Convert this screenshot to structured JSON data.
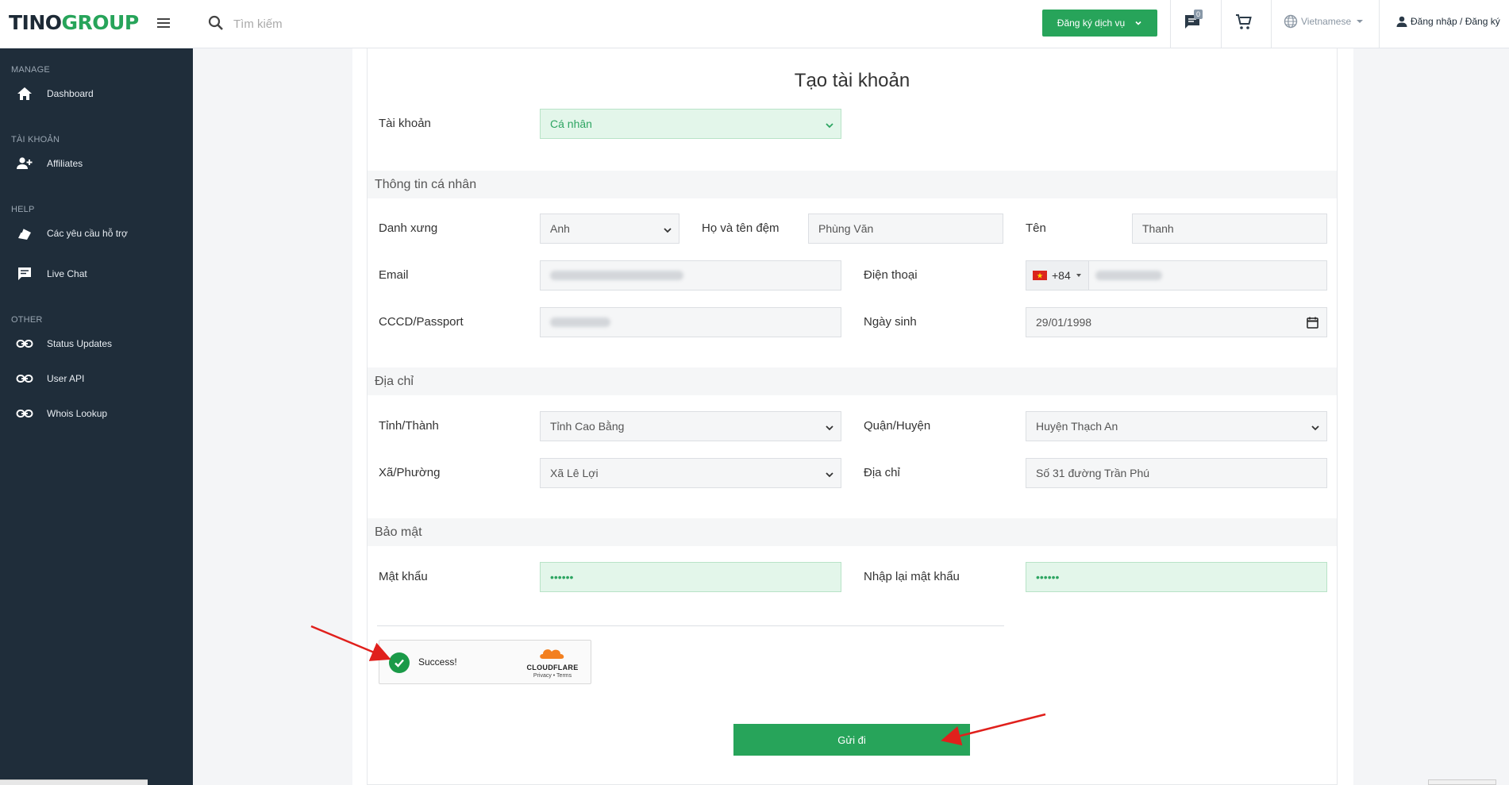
{
  "app": {
    "logo_part1": "TINO",
    "logo_part2": "GROUP"
  },
  "topbar": {
    "search_placeholder": "Tìm kiếm",
    "register_label": "Đăng ký dịch vụ",
    "chat_badge": "0",
    "language": "Vietnamese",
    "login_label": "Đăng nhập / Đăng ký"
  },
  "sidebar": {
    "sections": [
      {
        "title": "MANAGE",
        "items": [
          {
            "label": "Dashboard",
            "icon": "home-icon"
          }
        ]
      },
      {
        "title": "TÀI KHOẢN",
        "items": [
          {
            "label": "Affiliates",
            "icon": "user-plus-icon"
          }
        ]
      },
      {
        "title": "HELP",
        "items": [
          {
            "label": "Các yêu cầu hỗ trợ",
            "icon": "ticket-icon"
          },
          {
            "label": "Live Chat",
            "icon": "chat-icon"
          }
        ]
      },
      {
        "title": "OTHER",
        "items": [
          {
            "label": "Status Updates",
            "icon": "link-icon"
          },
          {
            "label": "User API",
            "icon": "link-icon"
          },
          {
            "label": "Whois Lookup",
            "icon": "link-icon"
          }
        ]
      }
    ]
  },
  "form": {
    "title": "Tạo tài khoản",
    "account_type": {
      "label": "Tài khoản",
      "value": "Cá nhân"
    },
    "personal": {
      "heading": "Thông tin cá nhân",
      "salutation": {
        "label": "Danh xưng",
        "value": "Anh"
      },
      "middle_name": {
        "label": "Họ và tên đệm",
        "value": "Phùng Văn"
      },
      "first_name": {
        "label": "Tên",
        "value": "Thanh"
      },
      "email": {
        "label": "Email"
      },
      "phone": {
        "label": "Điện thoại",
        "country_code": "+84"
      },
      "id_number": {
        "label": "CCCD/Passport"
      },
      "birthday": {
        "label": "Ngày sinh",
        "value": "29/01/1998"
      }
    },
    "address": {
      "heading": "Địa chỉ",
      "province": {
        "label": "Tỉnh/Thành",
        "value": "Tỉnh Cao Bằng"
      },
      "district": {
        "label": "Quận/Huyện",
        "value": "Huyện Thạch An"
      },
      "ward": {
        "label": "Xã/Phường",
        "value": "Xã Lê Lợi"
      },
      "street": {
        "label": "Địa chỉ",
        "value": "Số 31 đường Trần Phú"
      }
    },
    "security": {
      "heading": "Bảo mật",
      "password": {
        "label": "Mật khẩu",
        "value": "••••••"
      },
      "password_confirm": {
        "label": "Nhập lại mật khẩu",
        "value": "••••••"
      }
    },
    "captcha": {
      "status": "Success!",
      "provider": "CLOUDFLARE",
      "links": "Privacy • Terms"
    },
    "submit_label": "Gửi đi"
  },
  "colors": {
    "brand_green": "#27a45a",
    "sidebar_bg": "#1f2d3a",
    "annotation_arrow": "#e0201c",
    "cloudflare_orange": "#f38020"
  }
}
